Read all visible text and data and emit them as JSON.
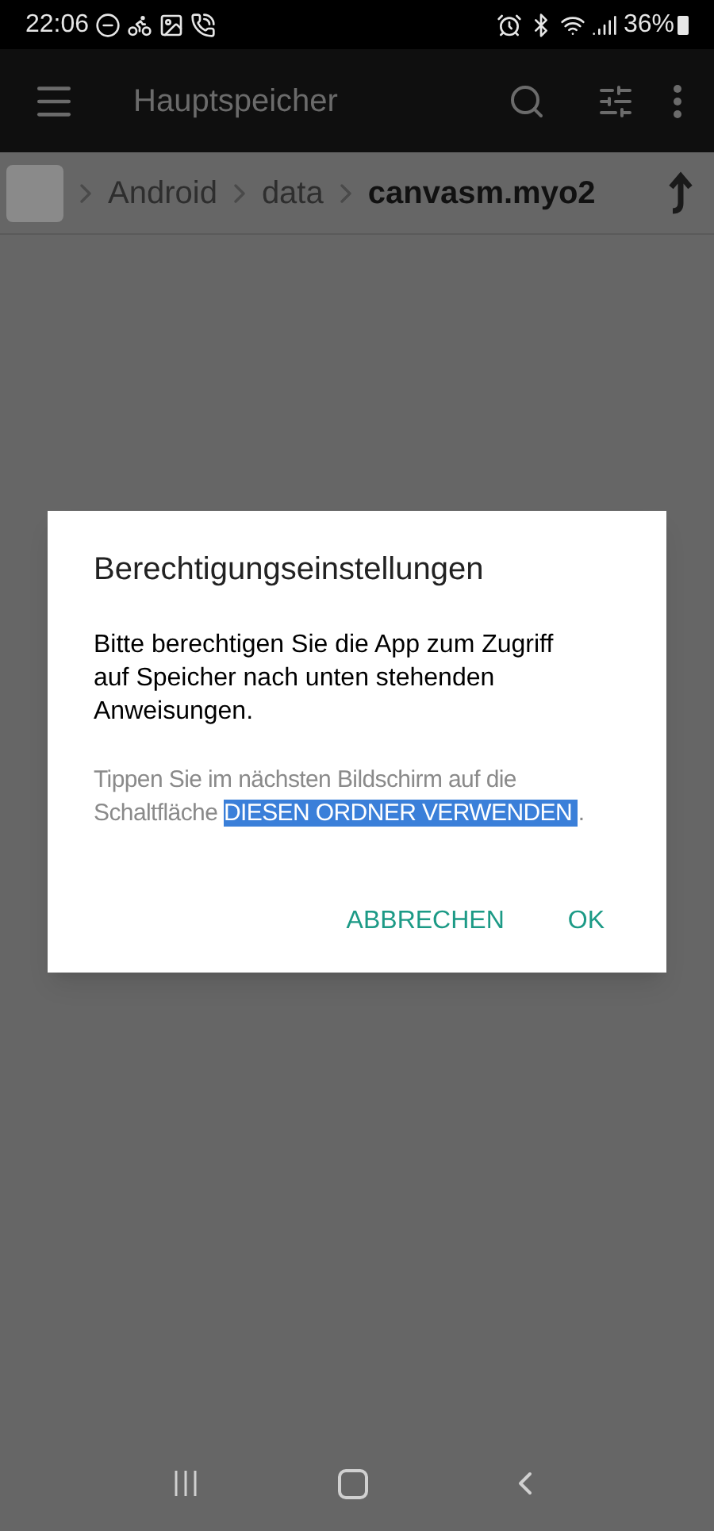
{
  "status_bar": {
    "time": "22:06",
    "battery": "36%"
  },
  "toolbar": {
    "title": "Hauptspeicher"
  },
  "breadcrumb": [
    {
      "label": "Android",
      "current": false
    },
    {
      "label": "data",
      "current": false
    },
    {
      "label": "canvasm.myo2",
      "current": true
    }
  ],
  "dialog": {
    "title": "Berechtigungseinstellungen",
    "message": "Bitte berechtigen Sie die App zum Zugriff auf Speicher nach unten stehenden Anweisungen.",
    "hint": {
      "before": "Tippen Sie im nächsten Bildschirm auf die Schaltfläche ",
      "highlight": " DIESEN ORDNER VERWENDEN ",
      "after": "."
    },
    "buttons": [
      "ABBRECHEN",
      "OK"
    ]
  }
}
